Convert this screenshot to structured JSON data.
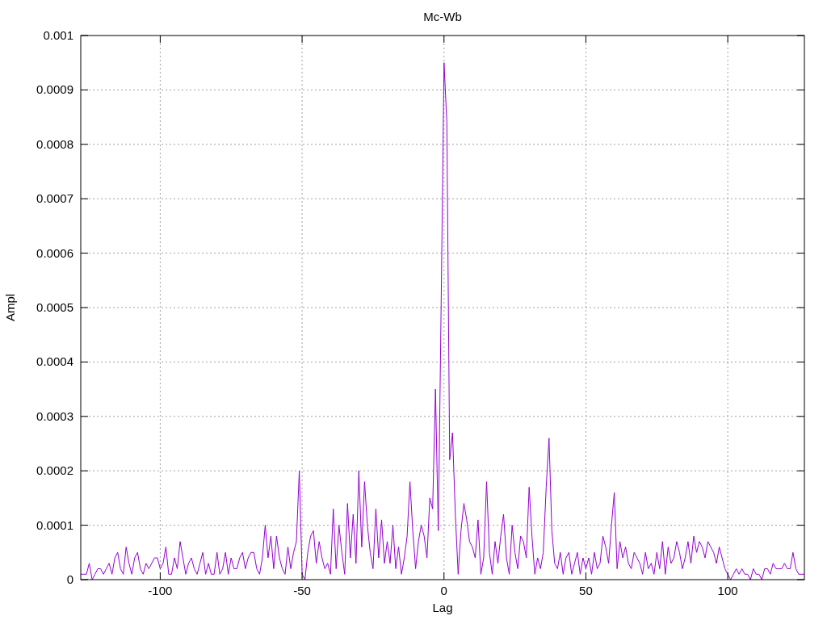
{
  "chart": {
    "chart_data": {
      "type": "line",
      "title": "Mc-Wb",
      "xlabel": "Lag",
      "ylabel": "Ampl",
      "grid": true,
      "xlim": [
        -128,
        127
      ],
      "ylim": [
        0,
        0.001
      ],
      "xticks": [
        -100,
        -50,
        0,
        50,
        100
      ],
      "yticks": [
        {
          "value": 0,
          "label": "0"
        },
        {
          "value": 0.0001,
          "label": "0.0001"
        },
        {
          "value": 0.0002,
          "label": "0.0002"
        },
        {
          "value": 0.0003,
          "label": "0.0003"
        },
        {
          "value": 0.0004,
          "label": "0.0004"
        },
        {
          "value": 0.0005,
          "label": "0.0005"
        },
        {
          "value": 0.0006,
          "label": "0.0006"
        },
        {
          "value": 0.0007,
          "label": "0.0007"
        },
        {
          "value": 0.0008,
          "label": "0.0008"
        },
        {
          "value": 0.0009,
          "label": "0.0009"
        },
        {
          "value": 0.001,
          "label": "0.001"
        }
      ],
      "x": [
        -128,
        -127,
        -126,
        -125,
        -124,
        -123,
        -122,
        -121,
        -120,
        -119,
        -118,
        -117,
        -116,
        -115,
        -114,
        -113,
        -112,
        -111,
        -110,
        -109,
        -108,
        -107,
        -106,
        -105,
        -104,
        -103,
        -102,
        -101,
        -100,
        -99,
        -98,
        -97,
        -96,
        -95,
        -94,
        -93,
        -92,
        -91,
        -90,
        -89,
        -88,
        -87,
        -86,
        -85,
        -84,
        -83,
        -82,
        -81,
        -80,
        -79,
        -78,
        -77,
        -76,
        -75,
        -74,
        -73,
        -72,
        -71,
        -70,
        -69,
        -68,
        -67,
        -66,
        -65,
        -64,
        -63,
        -62,
        -61,
        -60,
        -59,
        -58,
        -57,
        -56,
        -55,
        -54,
        -53,
        -52,
        -51,
        -50,
        -49,
        -48,
        -47,
        -46,
        -45,
        -44,
        -43,
        -42,
        -41,
        -40,
        -39,
        -38,
        -37,
        -36,
        -35,
        -34,
        -33,
        -32,
        -31,
        -30,
        -29,
        -28,
        -27,
        -26,
        -25,
        -24,
        -23,
        -22,
        -21,
        -20,
        -19,
        -18,
        -17,
        -16,
        -15,
        -14,
        -13,
        -12,
        -11,
        -10,
        -9,
        -8,
        -7,
        -6,
        -5,
        -4,
        -3,
        -2,
        -1,
        0,
        1,
        2,
        3,
        4,
        5,
        6,
        7,
        8,
        9,
        10,
        11,
        12,
        13,
        14,
        15,
        16,
        17,
        18,
        19,
        20,
        21,
        22,
        23,
        24,
        25,
        26,
        27,
        28,
        29,
        30,
        31,
        32,
        33,
        34,
        35,
        36,
        37,
        38,
        39,
        40,
        41,
        42,
        43,
        44,
        45,
        46,
        47,
        48,
        49,
        50,
        51,
        52,
        53,
        54,
        55,
        56,
        57,
        58,
        59,
        60,
        61,
        62,
        63,
        64,
        65,
        66,
        67,
        68,
        69,
        70,
        71,
        72,
        73,
        74,
        75,
        76,
        77,
        78,
        79,
        80,
        81,
        82,
        83,
        84,
        85,
        86,
        87,
        88,
        89,
        90,
        91,
        92,
        93,
        94,
        95,
        96,
        97,
        98,
        99,
        100,
        101,
        102,
        103,
        104,
        105,
        106,
        107,
        108,
        109,
        110,
        111,
        112,
        113,
        114,
        115,
        116,
        117,
        118,
        119,
        120,
        121,
        122,
        123,
        124,
        125,
        126,
        127
      ],
      "series": [
        {
          "color": "#9400d3",
          "values": [
            1e-05,
            1e-05,
            1e-05,
            3e-05,
            0,
            1e-05,
            2e-05,
            2e-05,
            1e-05,
            2e-05,
            3e-05,
            1e-05,
            4e-05,
            5e-05,
            2e-05,
            1e-05,
            6e-05,
            3e-05,
            1e-05,
            4e-05,
            5e-05,
            2e-05,
            1e-05,
            3e-05,
            2e-05,
            3e-05,
            4e-05,
            4e-05,
            2e-05,
            3e-05,
            6e-05,
            1e-05,
            1e-05,
            4e-05,
            2e-05,
            7e-05,
            4e-05,
            1e-05,
            3e-05,
            4e-05,
            2e-05,
            1e-05,
            3e-05,
            5e-05,
            1e-05,
            3e-05,
            1e-05,
            1e-05,
            5e-05,
            1e-05,
            2e-05,
            5e-05,
            1e-05,
            4e-05,
            2e-05,
            2e-05,
            4e-05,
            5e-05,
            2e-05,
            4e-05,
            5e-05,
            5e-05,
            2e-05,
            1e-05,
            4e-05,
            0.0001,
            4e-05,
            8e-05,
            2e-05,
            8e-05,
            4e-05,
            2e-05,
            1e-05,
            6e-05,
            2e-05,
            5e-05,
            7e-05,
            0.0002,
            1e-05,
            0,
            5e-05,
            8e-05,
            9e-05,
            3e-05,
            7e-05,
            4e-05,
            2e-05,
            3e-05,
            1e-05,
            0.00013,
            2e-05,
            0.0001,
            5e-05,
            1e-05,
            0.00014,
            4e-05,
            0.00012,
            3e-05,
            0.0002,
            6e-05,
            0.00018,
            0.0001,
            5e-05,
            2e-05,
            0.00013,
            4e-05,
            0.00011,
            3e-05,
            7e-05,
            3e-05,
            0.0001,
            2e-05,
            6e-05,
            1e-05,
            4e-05,
            8e-05,
            0.00018,
            9e-05,
            2e-05,
            7e-05,
            0.0001,
            8e-05,
            4e-05,
            0.00015,
            0.00013,
            0.00035,
            9e-05,
            0.0005,
            0.00095,
            0.00084,
            0.00022,
            0.00027,
            0.00012,
            1e-05,
            9e-05,
            0.00014,
            0.00011,
            7e-05,
            6e-05,
            4e-05,
            0.00011,
            1e-05,
            4e-05,
            0.00018,
            5e-05,
            1e-05,
            7e-05,
            3e-05,
            8e-05,
            0.00012,
            4e-05,
            1e-05,
            0.0001,
            5e-05,
            2e-05,
            8e-05,
            7e-05,
            4e-05,
            0.00017,
            8e-05,
            1e-05,
            4e-05,
            2e-05,
            5e-05,
            0.00017,
            0.00026,
            9e-05,
            3e-05,
            2e-05,
            5e-05,
            1e-05,
            4e-05,
            5e-05,
            1e-05,
            3e-05,
            5e-05,
            1e-05,
            4e-05,
            2e-05,
            4e-05,
            1e-05,
            5e-05,
            2e-05,
            3e-05,
            8e-05,
            6e-05,
            3e-05,
            0.0001,
            0.00016,
            2e-05,
            7e-05,
            4e-05,
            6e-05,
            3e-05,
            2e-05,
            5e-05,
            4e-05,
            3e-05,
            1e-05,
            5e-05,
            2e-05,
            3e-05,
            1e-05,
            5e-05,
            2e-05,
            7e-05,
            1e-05,
            6e-05,
            3e-05,
            4e-05,
            7e-05,
            5e-05,
            2e-05,
            4e-05,
            7e-05,
            3e-05,
            8e-05,
            5e-05,
            7e-05,
            6e-05,
            4e-05,
            7e-05,
            6e-05,
            5e-05,
            3e-05,
            6e-05,
            4e-05,
            2e-05,
            1e-05,
            0,
            1e-05,
            2e-05,
            1e-05,
            2e-05,
            1e-05,
            1e-05,
            0,
            2e-05,
            1e-05,
            1e-05,
            0,
            2e-05,
            2e-05,
            1e-05,
            3e-05,
            2e-05,
            2e-05,
            2e-05,
            3e-05,
            2e-05,
            2e-05,
            5e-05,
            2e-05,
            1e-05,
            1e-05,
            1e-05
          ]
        }
      ]
    }
  }
}
